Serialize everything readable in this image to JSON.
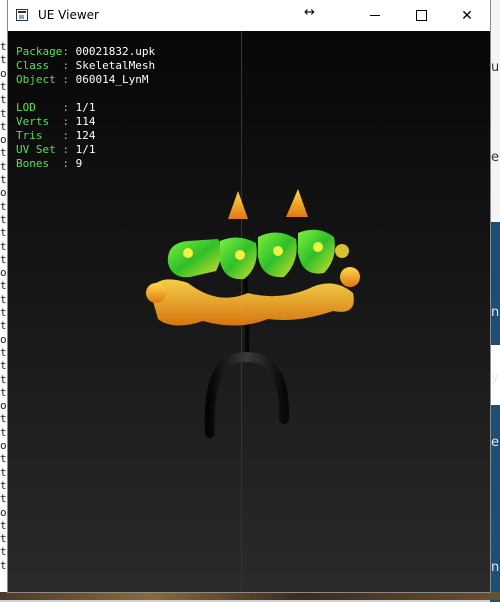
{
  "window": {
    "title": "UE Viewer",
    "resize_glyph": "↔"
  },
  "controls": {
    "minimize": "minimize-icon",
    "maximize": "maximize-icon",
    "close_glyph": "✕"
  },
  "info": {
    "package_label": "Package:",
    "package_value": "00021832.upk",
    "class_label": "Class  :",
    "class_value": "SkeletalMesh",
    "object_label": "Object :",
    "object_value": "060014_LynM",
    "lod_label": "LOD    :",
    "lod_value": "1/1",
    "verts_label": "Verts  :",
    "verts_value": "114",
    "tris_label": "Tris   :",
    "tris_value": "124",
    "uvset_label": "UV Set :",
    "uvset_value": "1/1",
    "bones_label": "Bones  :",
    "bones_value": "9"
  },
  "background": {
    "left_glyphs": [
      "t",
      "t",
      "o",
      "t",
      "t",
      "t",
      "t",
      "o",
      "t",
      "t",
      "t",
      "o",
      "t",
      "t",
      "t",
      "t",
      "t",
      "o",
      "t",
      "t",
      "t",
      "t",
      "o",
      "t",
      "t",
      "t",
      "t",
      "o",
      "t",
      "t",
      "o",
      "t",
      "t",
      "t",
      "t",
      "o",
      "t",
      "t",
      "t",
      "t"
    ],
    "right_glyphs": [
      "u",
      "e",
      "n",
      "y",
      "e",
      "n"
    ]
  },
  "colors": {
    "label_green": "#55e055",
    "value_white": "#ffffff",
    "axis_blue": "#2222c8"
  }
}
